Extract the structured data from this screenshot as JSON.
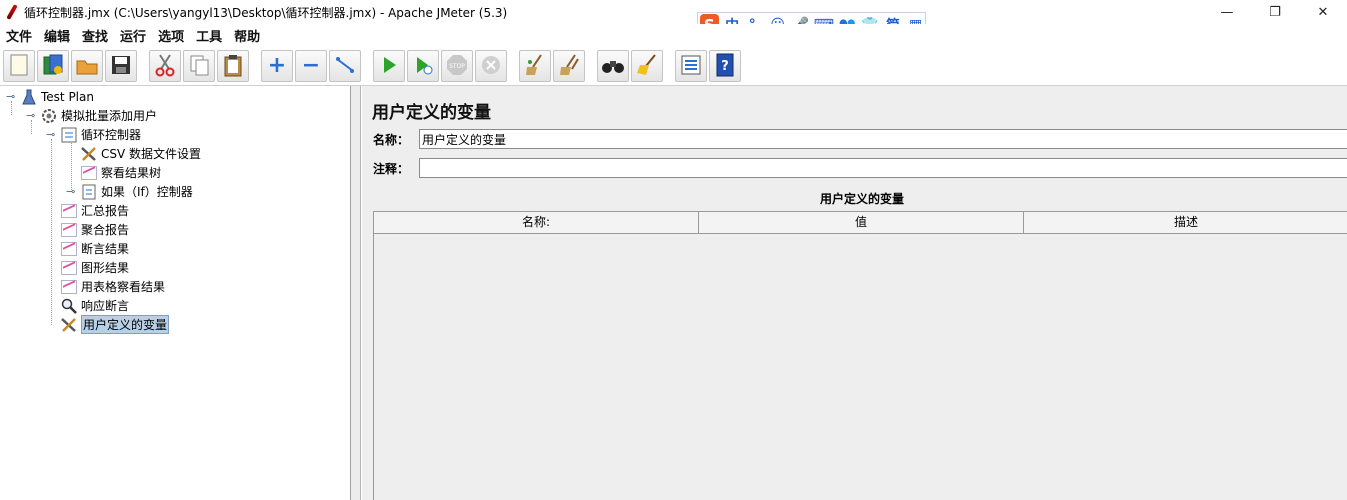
{
  "window": {
    "title": "循环控制器.jmx (C:\\Users\\yangyl13\\Desktop\\循环控制器.jmx) - Apache JMeter (5.3)",
    "minimize": "—",
    "maximize": "❐",
    "close": "✕"
  },
  "ime": {
    "logo": "S",
    "items": [
      "中",
      "°,",
      "☺",
      "🎤",
      "⌨",
      "👥",
      "👕",
      "简",
      "▦"
    ]
  },
  "menu": [
    "文件",
    "编辑",
    "查找",
    "运行",
    "选项",
    "工具",
    "帮助"
  ],
  "toolbar": {
    "buttons": [
      {
        "name": "new-icon",
        "glyph": "🗋"
      },
      {
        "name": "templates-icon",
        "glyph": "📗"
      },
      {
        "name": "open-icon",
        "glyph": "📂"
      },
      {
        "name": "save-icon",
        "glyph": "💾"
      },
      {
        "name": "cut-icon",
        "glyph": "✂"
      },
      {
        "name": "copy-icon",
        "glyph": "❐"
      },
      {
        "name": "paste-icon",
        "glyph": "📋"
      },
      {
        "name": "expand-icon",
        "glyph": "+"
      },
      {
        "name": "collapse-icon",
        "glyph": "−"
      },
      {
        "name": "toggle-icon",
        "glyph": "↘"
      },
      {
        "name": "start-icon",
        "glyph": "▶"
      },
      {
        "name": "start-no-pauses-icon",
        "glyph": "▶"
      },
      {
        "name": "stop-icon",
        "glyph": "STOP"
      },
      {
        "name": "shutdown-icon",
        "glyph": "✖"
      },
      {
        "name": "clear-icon",
        "glyph": "🧹"
      },
      {
        "name": "clear-all-icon",
        "glyph": "🧹"
      },
      {
        "name": "search-icon",
        "glyph": "🔭"
      },
      {
        "name": "reset-search-icon",
        "glyph": "🧹"
      },
      {
        "name": "function-helper-icon",
        "glyph": "☰"
      },
      {
        "name": "help-icon",
        "glyph": "?"
      }
    ]
  },
  "tree": [
    {
      "name": "tree-node-test-plan",
      "label": "Test Plan",
      "icon": "flask-icon"
    },
    {
      "name": "tree-node-thread-group",
      "label": "模拟批量添加用户",
      "icon": "gear-icon"
    },
    {
      "name": "tree-node-loop-controller",
      "label": "循环控制器",
      "icon": "loop-icon"
    },
    {
      "name": "tree-node-csv",
      "label": "CSV 数据文件设置",
      "icon": "wrench-icon"
    },
    {
      "name": "tree-node-view-results-tree",
      "label": "察看结果树",
      "icon": "graph-icon"
    },
    {
      "name": "tree-node-if-controller",
      "label": "如果（If）控制器",
      "icon": "if-icon"
    },
    {
      "name": "tree-node-summary-report",
      "label": "汇总报告",
      "icon": "graph-icon"
    },
    {
      "name": "tree-node-aggregate-report",
      "label": "聚合报告",
      "icon": "graph-icon"
    },
    {
      "name": "tree-node-assertion-results",
      "label": "断言结果",
      "icon": "graph-icon"
    },
    {
      "name": "tree-node-graph-results",
      "label": "图形结果",
      "icon": "graph-icon"
    },
    {
      "name": "tree-node-table-results",
      "label": "用表格察看结果",
      "icon": "graph-icon"
    },
    {
      "name": "tree-node-response-assertion",
      "label": "响应断言",
      "icon": "magnifier-icon"
    },
    {
      "name": "tree-node-user-defined-variables",
      "label": "用户定义的变量",
      "icon": "wrench-icon"
    }
  ],
  "panel": {
    "title": "用户定义的变量",
    "name_label": "名称：",
    "name_value": "用户定义的变量",
    "comment_label": "注释：",
    "comment_value": "",
    "group_title": "用户定义的变量",
    "columns": [
      "名称:",
      "值",
      "描述"
    ]
  }
}
